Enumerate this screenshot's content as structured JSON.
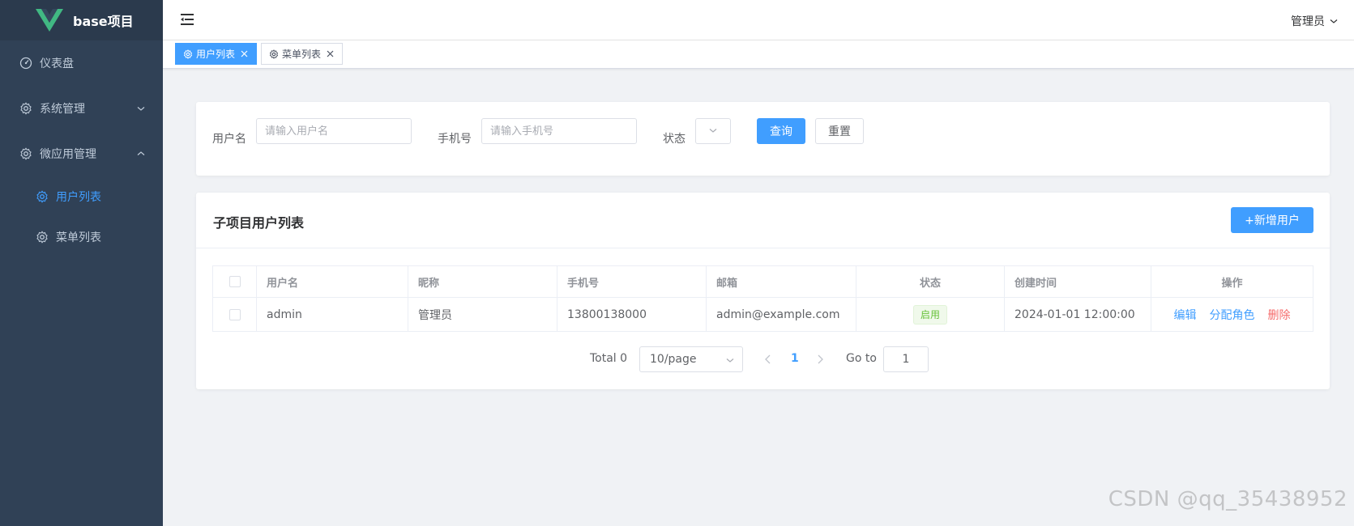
{
  "app": {
    "title": "base项目"
  },
  "sidebar": {
    "items": [
      {
        "label": "仪表盘",
        "icon": "dashboard-icon"
      },
      {
        "label": "系统管理",
        "icon": "gear-icon",
        "expanded": false
      },
      {
        "label": "微应用管理",
        "icon": "gear-icon",
        "expanded": true,
        "children": [
          {
            "label": "用户列表",
            "icon": "gear-icon",
            "active": true
          },
          {
            "label": "菜单列表",
            "icon": "gear-icon",
            "active": false
          }
        ]
      }
    ]
  },
  "header": {
    "user": "管理员"
  },
  "tags": [
    {
      "label": "用户列表",
      "active": true
    },
    {
      "label": "菜单列表",
      "active": false
    }
  ],
  "search": {
    "username_label": "用户名",
    "username_placeholder": "请输入用户名",
    "phone_label": "手机号",
    "phone_placeholder": "请输入手机号",
    "status_label": "状态",
    "query_button": "查询",
    "reset_button": "重置"
  },
  "list": {
    "title": "子项目用户列表",
    "add_button": "+新增用户",
    "columns": [
      "用户名",
      "昵称",
      "手机号",
      "邮箱",
      "状态",
      "创建时间",
      "操作"
    ],
    "rows": [
      {
        "username": "admin",
        "nickname": "管理员",
        "phone": "13800138000",
        "email": "admin@example.com",
        "status": "启用",
        "created": "2024-01-01 12:00:00"
      }
    ],
    "actions": {
      "edit": "编辑",
      "assign_role": "分配角色",
      "delete": "删除"
    }
  },
  "pagination": {
    "total": "Total 0",
    "page_size": "10/page",
    "current_page": "1",
    "goto_label": "Go to",
    "goto_value": "1"
  },
  "watermark": "CSDN @qq_35438952",
  "colors": {
    "primary": "#409eff",
    "sidebar": "#304156",
    "danger": "#f56c6c",
    "success": "#67c23a"
  }
}
